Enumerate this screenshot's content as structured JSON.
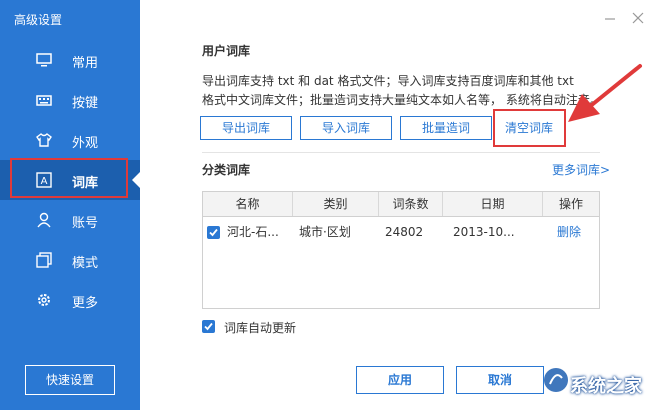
{
  "window": {
    "title": "高级设置"
  },
  "sidebar": {
    "items": [
      {
        "label": "常用",
        "icon": "monitor-icon"
      },
      {
        "label": "按键",
        "icon": "keyboard-icon"
      },
      {
        "label": "外观",
        "icon": "tshirt-icon"
      },
      {
        "label": "词库",
        "icon": "dictionary-icon",
        "active": true
      },
      {
        "label": "账号",
        "icon": "user-icon"
      },
      {
        "label": "模式",
        "icon": "mode-icon"
      },
      {
        "label": "更多",
        "icon": "gear-icon"
      }
    ],
    "quick_settings": "快速设置"
  },
  "user_lexicon": {
    "title": "用户词库",
    "desc_line1": "导出词库支持 txt 和 dat 格式文件；导入词库支持百度词库和其他 txt",
    "desc_line2": "格式中文词库文件；批量造词支持大量纯文本如人名等， 系统将自动注音。",
    "buttons": {
      "export": "导出词库",
      "import": "导入词库",
      "batch": "批量造词",
      "clear": "清空词库"
    }
  },
  "category_lexicon": {
    "title": "分类词库",
    "more_link": "更多词库>",
    "columns": [
      "名称",
      "类别",
      "词条数",
      "日期",
      "操作"
    ],
    "rows": [
      {
        "checked": true,
        "name": "河北-石...",
        "category": "城市·区划",
        "count": "24802",
        "date": "2013-10...",
        "action": "删除"
      }
    ]
  },
  "auto_update": {
    "checked": true,
    "label": "词库自动更新"
  },
  "footer": {
    "apply": "应用",
    "cancel": "取消"
  },
  "watermark": {
    "text": "系统之家"
  },
  "colors": {
    "accent": "#2a78d3",
    "sidebar_active": "#1c5fae",
    "highlight_red": "#e03a3a"
  }
}
